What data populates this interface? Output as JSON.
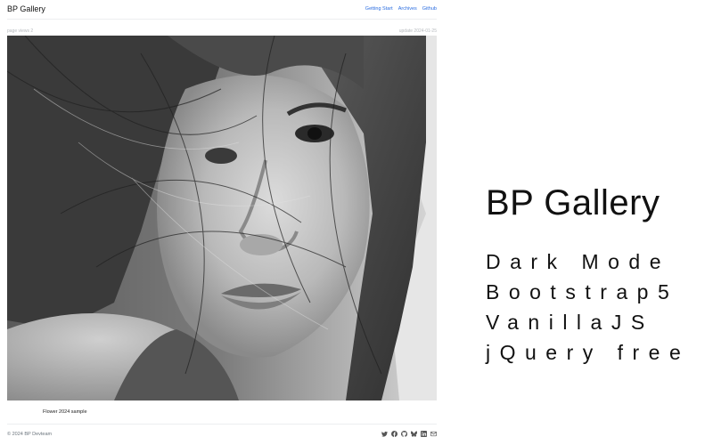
{
  "navbar": {
    "brand": "BP Gallery",
    "links": [
      {
        "label": "Getting Start"
      },
      {
        "label": "Archives"
      },
      {
        "label": "Github"
      }
    ]
  },
  "post": {
    "views": "page views 2",
    "update": "update 2024-01-25",
    "caption": "Flower 2024 sample"
  },
  "footer": {
    "copyright": "© 2024 BP Devteam",
    "social_icons": [
      "twitter-icon",
      "facebook-icon",
      "github-icon",
      "bluesky-icon",
      "linkedin-icon",
      "mail-icon"
    ]
  },
  "promo": {
    "title": "BP Gallery",
    "features": [
      "Dark Mode",
      "Bootstrap5",
      "VanillaJS",
      "jQuery free"
    ]
  },
  "colors": {
    "link": "#2b6de0",
    "muted_text": "#b5b9bd",
    "text": "#111111",
    "background": "#ffffff"
  }
}
